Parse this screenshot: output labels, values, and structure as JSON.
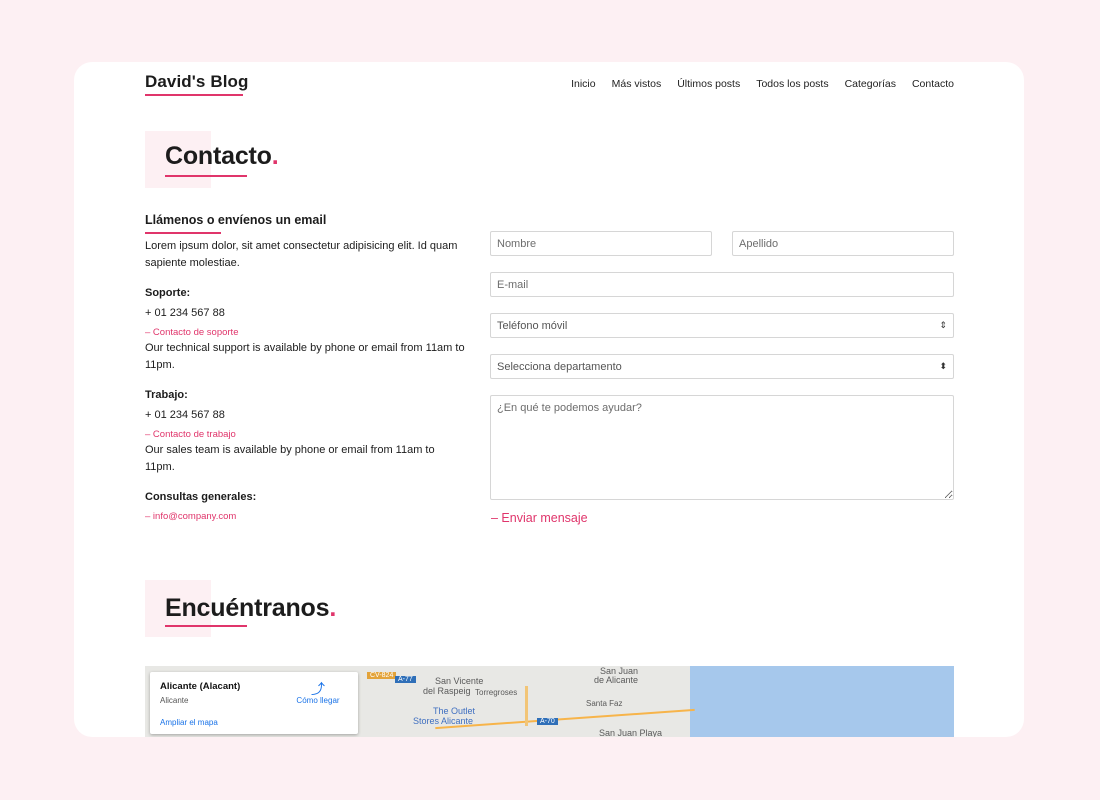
{
  "header": {
    "brand": "David's Blog",
    "nav": [
      "Inicio",
      "Más vistos",
      "Últimos posts",
      "Todos los posts",
      "Categorías",
      "Contacto"
    ]
  },
  "contact_section": {
    "title": "Contacto",
    "dot": "."
  },
  "info": {
    "heading": "Llámenos o envíenos un email",
    "intro": "Lorem ipsum dolor, sit amet consectetur adipisicing elit. Id quam sapiente molestiae.",
    "support": {
      "label": "Soporte:",
      "phone": "+ 01 234 567 88",
      "link": "– Contacto de soporte",
      "text": "Our technical support is available by phone or email from 11am to 11pm."
    },
    "work": {
      "label": "Trabajo:",
      "phone": "+ 01 234 567 88",
      "link": "– Contacto de trabajo",
      "text": "Our sales team is available by phone or email from 11am to 11pm."
    },
    "general": {
      "label": "Consultas generales:",
      "link": "– info@company.com"
    }
  },
  "form": {
    "first_name_placeholder": "Nombre",
    "last_name_placeholder": "Apellido",
    "email_placeholder": "E-mail",
    "phone_placeholder": "Teléfono móvil",
    "department_placeholder": "Selecciona departamento",
    "message_placeholder": "¿En qué te podemos ayudar?",
    "send_label": "– Enviar mensaje"
  },
  "find_section": {
    "title": "Encuéntranos",
    "dot": "."
  },
  "map": {
    "place_title": "Alicante (Alacant)",
    "place_sub": "Alicante",
    "enlarge_link": "Ampliar el mapa",
    "directions_label": "Cómo llegar",
    "labels": [
      "San Vicente",
      "del Raspeig",
      "Torregroses",
      "The Outlet",
      "Stores Alicante",
      "San Juan",
      "de Alicante",
      "Santa Faz",
      "San Juan Playa"
    ],
    "road_tags": [
      "CV-824",
      "A-77",
      "A-70"
    ]
  },
  "colors": {
    "accent": "#e0356b",
    "page_bg": "#fdf0f3"
  }
}
